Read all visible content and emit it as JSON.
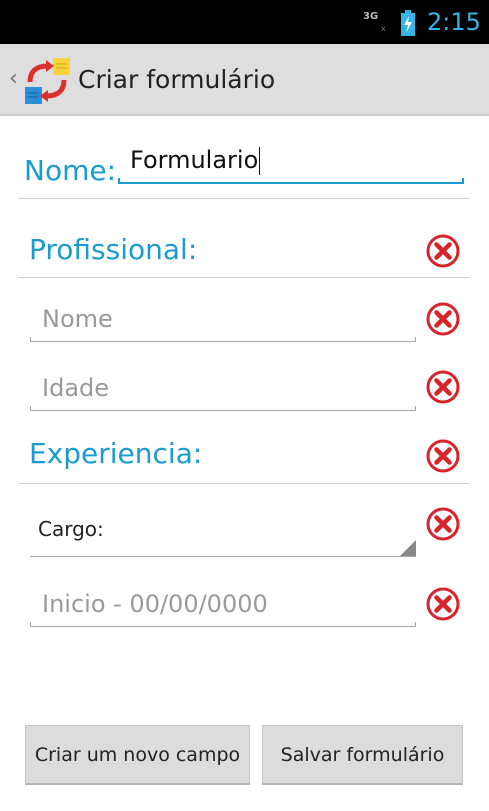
{
  "status_bar": {
    "network": "3G",
    "network_sub": "x",
    "time": "2:15"
  },
  "action_bar": {
    "up_glyph": "‹",
    "title": "Criar formulário",
    "app_icon": "swap-forms-icon"
  },
  "form": {
    "name_label": "Nome:",
    "name_value": "Formulario"
  },
  "sections": [
    {
      "title": "Profissional:",
      "fields": [
        {
          "type": "text",
          "placeholder": "Nome"
        },
        {
          "type": "text",
          "placeholder": "Idade"
        }
      ]
    },
    {
      "title": "Experiencia:",
      "fields": [
        {
          "type": "spinner",
          "value": "Cargo:"
        },
        {
          "type": "text",
          "placeholder": "Inicio - 00/00/0000"
        }
      ]
    }
  ],
  "icons": {
    "delete": "remove-circle-icon"
  },
  "colors": {
    "accent": "#1a9cd0",
    "delete": "#d8232a",
    "status_bar": "#000000",
    "clock": "#33b5e5"
  },
  "buttons": {
    "new_field": "Criar um novo campo",
    "save": "Salvar formulário"
  }
}
